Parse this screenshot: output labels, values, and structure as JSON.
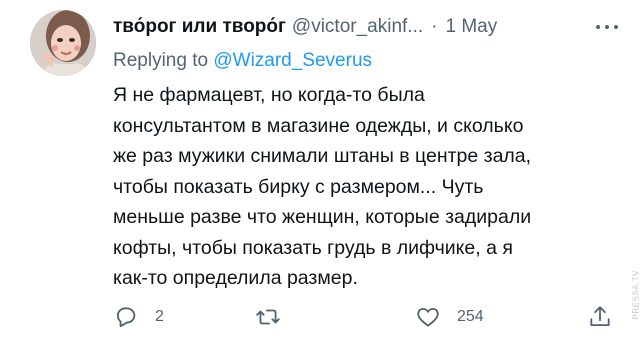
{
  "tweet": {
    "author_name": "тво́рог или творо́г",
    "handle": "@victor_akinf...",
    "separator": "·",
    "date": "1 May",
    "replying_prefix": "Replying to",
    "replying_handle": "@Wizard_Severus",
    "text_lines": [
      "Я не фармацевт, но когда-то была",
      "консультантом в магазине одежды, и сколько",
      "же раз мужики снимали штаны в центре зала,",
      "чтобы показать бирку с размером... Чуть",
      "меньше разве что женщин, которые задирали",
      "кофты, чтобы показать грудь в лифчике, а я",
      "как-то определила размер."
    ]
  },
  "actions": {
    "reply_count": "2",
    "retweet_count": "",
    "like_count": "254",
    "share_count": ""
  },
  "icons": {
    "more": "more-dots-icon",
    "reply": "reply-bubble-icon",
    "retweet": "retweet-icon",
    "like": "heart-icon",
    "share": "share-icon"
  },
  "colors": {
    "text": "#0f1419",
    "secondary": "#536471",
    "link": "#1d9bf0"
  },
  "watermark": "PRESSA.TV"
}
